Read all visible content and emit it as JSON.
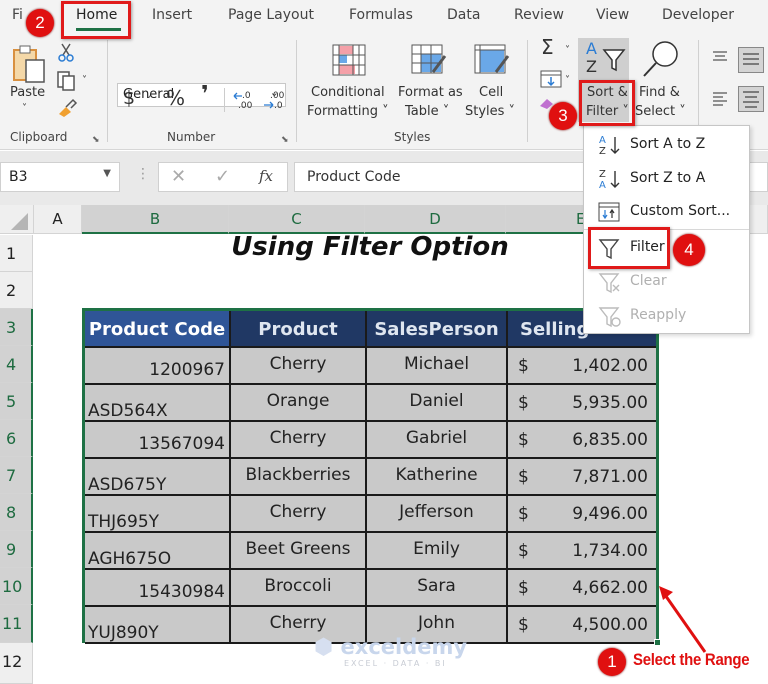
{
  "ribbon_tabs": [
    {
      "label": "File",
      "visible_text": "Fi"
    },
    {
      "label": "Home",
      "active": true
    },
    {
      "label": "Insert"
    },
    {
      "label": "Page Layout"
    },
    {
      "label": "Formulas"
    },
    {
      "label": "Data"
    },
    {
      "label": "Review"
    },
    {
      "label": "View"
    },
    {
      "label": "Developer"
    }
  ],
  "ribbon": {
    "clipboard": {
      "paste_label": "Paste",
      "group_label": "Clipboard"
    },
    "number": {
      "format_value": "General",
      "currency_symbol": "$",
      "percent_symbol": "%",
      "comma_symbol": "’",
      "group_label": "Number"
    },
    "styles": {
      "conditional_formatting_line1": "Conditional",
      "conditional_formatting_line2": "Formatting ˅",
      "format_as_table_line1": "Format as",
      "format_as_table_line2": "Table ˅",
      "cell_styles_line1": "Cell",
      "cell_styles_line2": "Styles ˅",
      "group_label": "Styles"
    },
    "editing": {
      "sort_filter_line1": "Sort &",
      "sort_filter_line2": "Filter ˅",
      "find_select_line1": "Find &",
      "find_select_line2": "Select ˅"
    }
  },
  "sort_filter_menu": [
    {
      "label": "Sort A to Z",
      "enabled": true
    },
    {
      "label": "Sort Z to A",
      "enabled": true
    },
    {
      "label": "Custom Sort...",
      "enabled": true
    },
    {
      "label": "Filter",
      "enabled": true
    },
    {
      "label": "Clear",
      "enabled": false
    },
    {
      "label": "Reapply",
      "enabled": false
    }
  ],
  "formula_bar": {
    "name_box": "B3",
    "fx": "fx",
    "formula": "Product Code"
  },
  "columns": [
    "A",
    "B",
    "C",
    "D",
    "E"
  ],
  "rows": [
    "1",
    "2",
    "3",
    "4",
    "5",
    "6",
    "7",
    "8",
    "9",
    "10",
    "11",
    "12"
  ],
  "sheet": {
    "title": "Using Filter Option",
    "table": {
      "headers": [
        "Product Code",
        "Product",
        "SalesPerson",
        "Selling"
      ],
      "rows": [
        {
          "code": "1200967",
          "code_numeric": true,
          "product": "Cherry",
          "salesperson": "Michael",
          "currency": "$",
          "selling": "1,402.00"
        },
        {
          "code": "ASD564X",
          "code_numeric": false,
          "product": "Orange",
          "salesperson": "Daniel",
          "currency": "$",
          "selling": "5,935.00"
        },
        {
          "code": "13567094",
          "code_numeric": true,
          "product": "Cherry",
          "salesperson": "Gabriel",
          "currency": "$",
          "selling": "6,835.00"
        },
        {
          "code": "ASD675Y",
          "code_numeric": false,
          "product": "Blackberries",
          "salesperson": "Katherine",
          "currency": "$",
          "selling": "7,871.00"
        },
        {
          "code": "THJ695Y",
          "code_numeric": false,
          "product": "Cherry",
          "salesperson": "Jefferson",
          "currency": "$",
          "selling": "9,496.00"
        },
        {
          "code": "AGH675O",
          "code_numeric": false,
          "product": "Beet Greens",
          "salesperson": "Emily",
          "currency": "$",
          "selling": "1,734.00"
        },
        {
          "code": "15430984",
          "code_numeric": true,
          "product": "Broccoli",
          "salesperson": "Sara",
          "currency": "$",
          "selling": "4,662.00"
        },
        {
          "code": "YUJ890Y",
          "code_numeric": false,
          "product": "Cherry",
          "salesperson": "John",
          "currency": "$",
          "selling": "4,500.00"
        }
      ]
    }
  },
  "annotations": {
    "step1": "1",
    "step1_text": "Select the Range",
    "step2": "2",
    "step3": "3",
    "step4": "4"
  },
  "watermark": {
    "brand": "exceldemy",
    "tagline": "EXCEL · DATA · BI"
  },
  "colors": {
    "accent_green": "#1e7145",
    "header_dark": "#203864",
    "header_first": "#2f5597",
    "callout_red": "#e01010",
    "cell_fill": "#c9c9c9"
  }
}
